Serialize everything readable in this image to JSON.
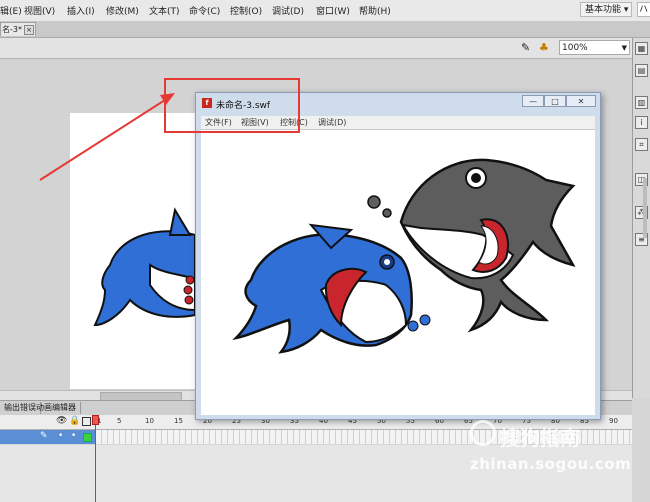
{
  "menubar": {
    "items": [
      "辑(E)",
      "视图(V)",
      "插入(I)",
      "修改(M)",
      "文本(T)",
      "命令(C)",
      "控制(O)",
      "调试(D)",
      "窗口(W)",
      "帮助(H)"
    ],
    "workspace": "基本功能",
    "search_partial": "ハ"
  },
  "doc_tab": {
    "label": "名-3*",
    "close": "×"
  },
  "editbar": {
    "zoom": "100%"
  },
  "swf": {
    "title": "未命名-3.swf",
    "menus": [
      "文件(F)",
      "视图(V)",
      "控制(C)",
      "调试(D)"
    ],
    "controls": {
      "minimize": "—",
      "maximize": "□",
      "close": "✕"
    }
  },
  "timeline": {
    "tabs": [
      "输出错误",
      "动画编辑器"
    ],
    "ruler": [
      "1",
      "5",
      "10",
      "15",
      "20",
      "25",
      "30",
      "35",
      "40",
      "45",
      "50",
      "55",
      "60",
      "65",
      "70",
      "75",
      "80",
      "85",
      "90"
    ],
    "layer_marks": "•"
  },
  "watermark": {
    "name": "搜狗指南",
    "url": "zhinan.sogou.com"
  },
  "colors": {
    "annotation": "#e53935",
    "shark_blue": "#2f6fd6",
    "shark_gray": "#5d5d5d",
    "mouth_red": "#c8262c"
  }
}
